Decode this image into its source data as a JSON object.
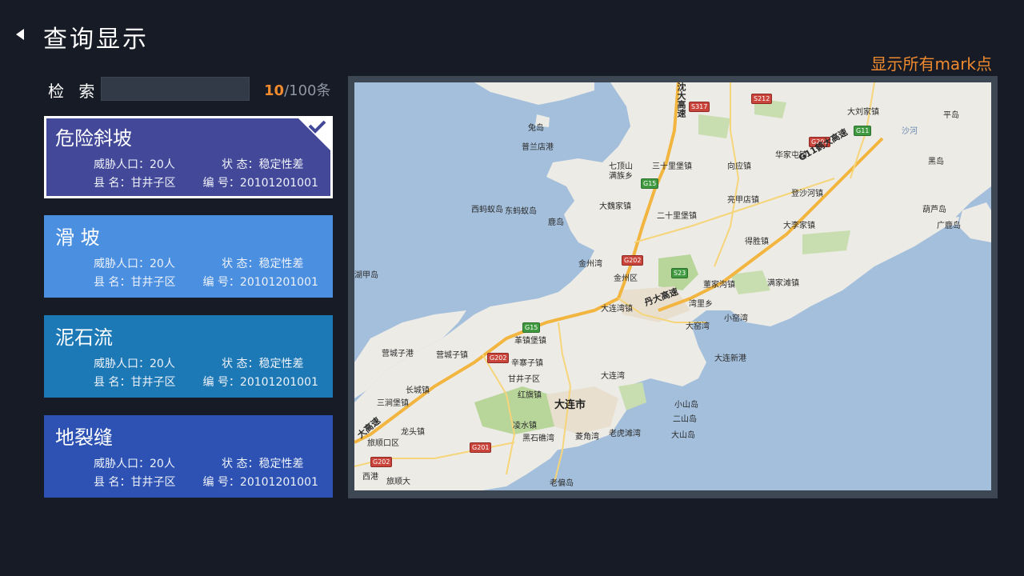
{
  "header": {
    "back_icon": "back-arrow-icon",
    "title": "查询显示",
    "show_all_label": "显示所有mark点"
  },
  "search": {
    "label": "检 索",
    "value": "",
    "count_current": "10",
    "count_total": "/100条"
  },
  "cards": [
    {
      "title": "危险斜坡",
      "selected": true,
      "color": "#434899",
      "k1": "威胁人口：",
      "v1": "20人",
      "k2": "状 态：",
      "v2": "稳定性差",
      "k3": "县 名：",
      "v3": "甘井子区",
      "k4": "编 号：",
      "v4": "20101201001"
    },
    {
      "title": "滑 坡",
      "selected": false,
      "color": "#4a8fe0",
      "k1": "威胁人口：",
      "v1": "20人",
      "k2": "状 态：",
      "v2": "稳定性差",
      "k3": "县 名：",
      "v3": "甘井子区",
      "k4": "编 号：",
      "v4": "20101201001"
    },
    {
      "title": "泥石流",
      "selected": false,
      "color": "#1d79b5",
      "k1": "威胁人口：",
      "v1": "20人",
      "k2": "状 态：",
      "v2": "稳定性差",
      "k3": "县 名：",
      "v3": "甘井子区",
      "k4": "编 号：",
      "v4": "20101201001"
    },
    {
      "title": "地裂缝",
      "selected": false,
      "color": "#2d52b3",
      "k1": "威胁人口：",
      "v1": "20人",
      "k2": "状 态：",
      "v2": "稳定性差",
      "k3": "县 名：",
      "v3": "甘井子区",
      "k4": "编 号：",
      "v4": "20101201001"
    }
  ],
  "map": {
    "places": {
      "tuodao": "兔岛",
      "pusandian": "普兰店港",
      "daliuzhen": "大刘家镇",
      "pingdao": "平岛",
      "shahe": "沙河",
      "huajiatun": "华家屯镇",
      "heidao": "黑岛",
      "sanshilipu": "三十里堡镇",
      "xiangying": "向应镇",
      "qidingshan": "七顶山",
      "manzu": "满族乡",
      "xixiadao": "西蚂蚁岛",
      "dongxiadao": "东蚂蚁岛",
      "dawei": "大魏家镇",
      "liangjia": "亮甲店镇",
      "dengsha": "登沙河镇",
      "hulu": "葫芦岛",
      "guangludao": "广鹿岛",
      "luandao": "鹿岛",
      "ershilipu": "二十里堡镇",
      "dalijia": "大李家镇",
      "dezheng": "得胜镇",
      "jinzhouwan": "金州湾",
      "jinzhouqu": "金州区",
      "huxiao": "湖甲岛",
      "dongjiagou": "董家沟镇",
      "manjiatan": "满家滩镇",
      "dalianwanzhen": "大连湾镇",
      "wanlixiang": "湾里乡",
      "xiaoyaowan": "小窑湾",
      "dayaowan": "大窑湾",
      "yingchengzi": "营城子港",
      "yingchengzizhen": "营城子镇",
      "gejiazhen": "革镇堡镇",
      "xinzhaizi": "辛寨子镇",
      "ganjingzi": "甘井子区",
      "dalianwan": "大连湾",
      "daliangang": "大连新港",
      "sanjianbao": "三涧堡镇",
      "changcheng": "长城镇",
      "hongqi": "红旗镇",
      "dalianshi": "大连市",
      "xiaoshandao": "小山岛",
      "ershandao": "二山岛",
      "dashandao": "大山岛",
      "longtou": "龙头镇",
      "lingshui": "凌水镇",
      "lvshunkou": "旅顺口区",
      "heishijiao": "黑石礁湾",
      "lingjiao": "菱角湾",
      "laohutan": "老虎滩湾",
      "xigang": "西港",
      "lvshunda": "旅顺大",
      "laotieshan": "老偏岛"
    },
    "shields": {
      "s317": "S317",
      "s212": "S212",
      "g11": "G11",
      "g201a": "G201",
      "g15a": "G15",
      "g202a": "G202",
      "s23": "S23",
      "g15b": "G15",
      "g202b": "G202",
      "g201b": "G201",
      "g202c": "G202"
    },
    "highways": {
      "shenda": "沈大高速",
      "g11hd": "G11鹤大高速",
      "danda": "丹大高速",
      "daxiao": "大高速"
    }
  }
}
